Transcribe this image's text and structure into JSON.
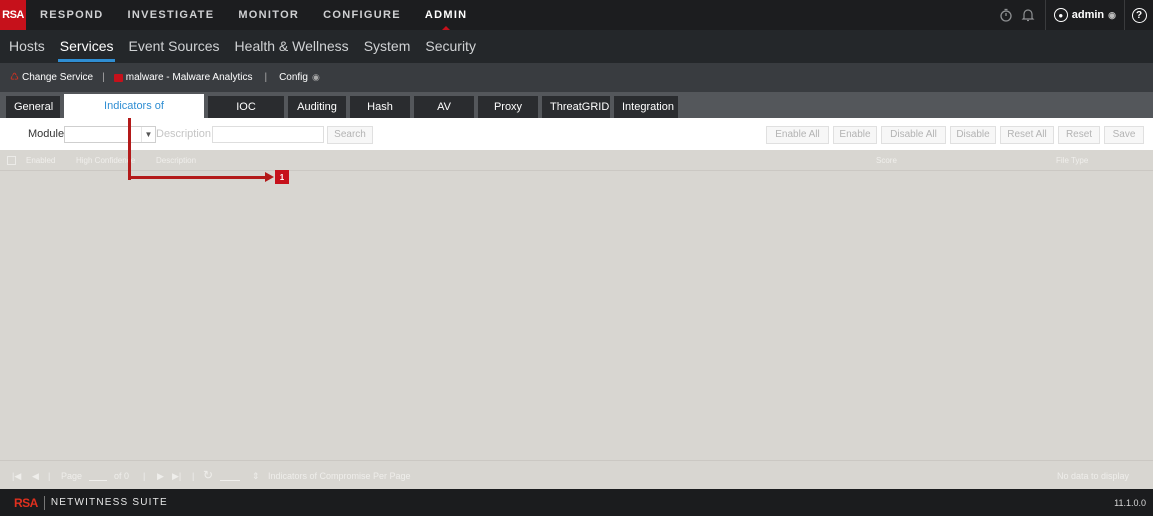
{
  "topnav": {
    "logo": "RSA",
    "items": [
      "RESPOND",
      "INVESTIGATE",
      "MONITOR",
      "CONFIGURE",
      "ADMIN"
    ],
    "active": "ADMIN",
    "user": "admin"
  },
  "secnav": {
    "items": [
      "Hosts",
      "Services",
      "Event Sources",
      "Health & Wellness",
      "System",
      "Security"
    ],
    "active": "Services"
  },
  "servicebar": {
    "change_service": "Change Service",
    "service_name": "malware - Malware Analytics",
    "config": "Config"
  },
  "tabs": {
    "items": [
      "General",
      "Indicators of Compromise",
      "IOC Summary",
      "Auditing",
      "Hash",
      "AV",
      "Proxy",
      "ThreatGRID",
      "Integration"
    ],
    "active": "Indicators of Compromise"
  },
  "toolbar": {
    "module_label": "Module",
    "description_label": "Description",
    "search_label": "Search",
    "enable_all": "Enable All",
    "enable": "Enable",
    "disable_all": "Disable All",
    "disable": "Disable",
    "reset_all": "Reset All",
    "reset": "Reset",
    "save": "Save"
  },
  "grid": {
    "columns": [
      "Enabled",
      "High Confidence",
      "Description",
      "Score",
      "File Type"
    ],
    "pager": {
      "page_label": "Page",
      "of_label": "of 0",
      "per_page_label": "Indicators of Compromise Per Page",
      "status": "No data to display"
    }
  },
  "annotation": {
    "callout": "1"
  },
  "footer": {
    "logo": "RSA",
    "product": "NETWITNESS SUITE",
    "version": "11.1.0.0"
  },
  "colors": {
    "brand_red": "#c6111b",
    "active_blue": "#2f8ed3",
    "grid_bg": "#d8d6d1"
  }
}
